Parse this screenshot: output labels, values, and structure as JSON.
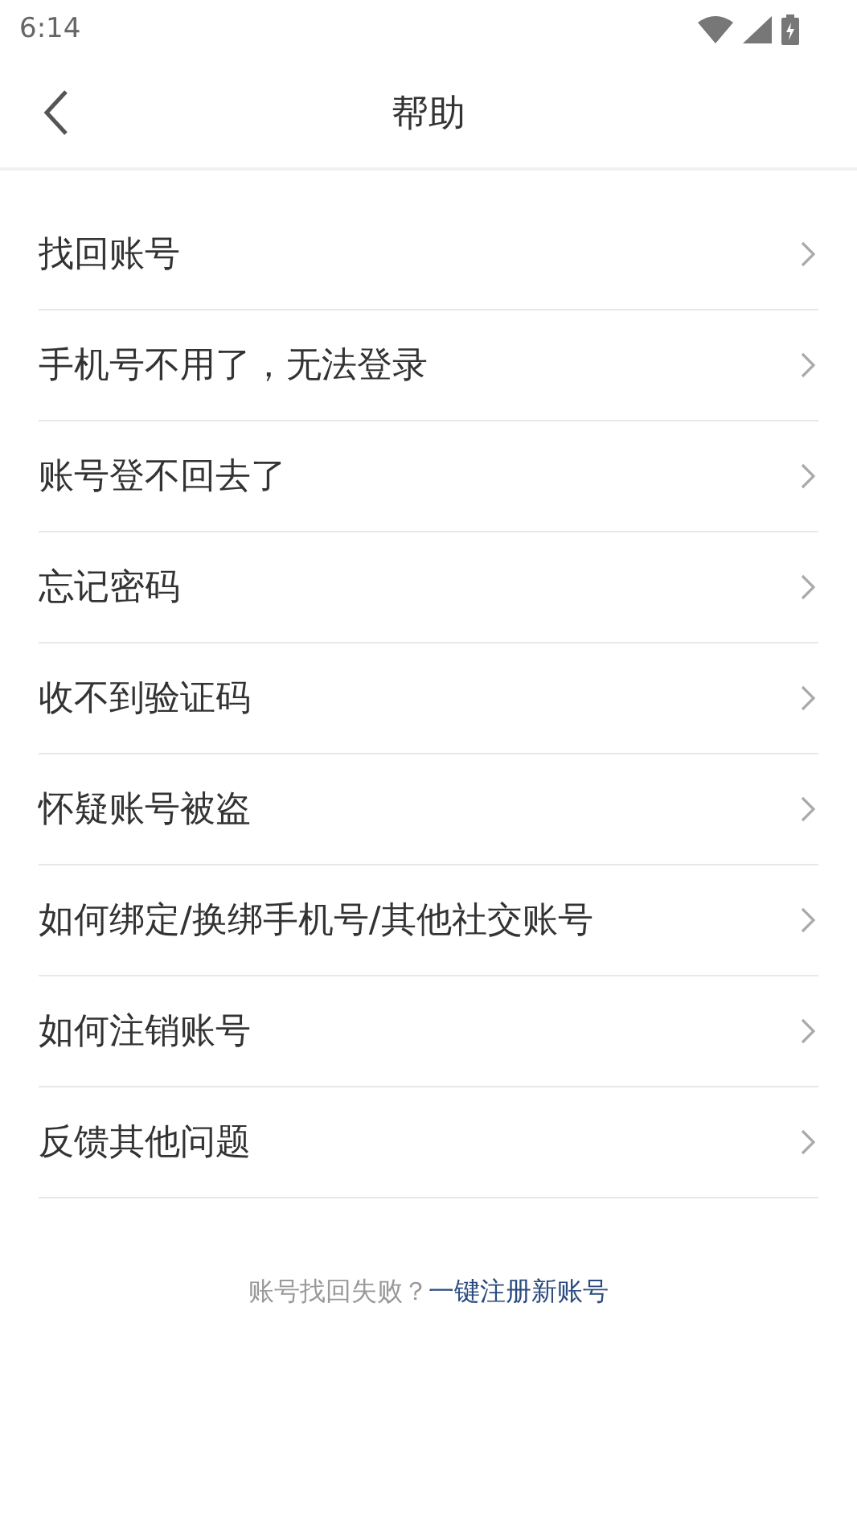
{
  "status_bar": {
    "time": "6:14"
  },
  "header": {
    "title": "帮助"
  },
  "items": [
    {
      "label": "找回账号"
    },
    {
      "label": "手机号不用了，无法登录"
    },
    {
      "label": "账号登不回去了"
    },
    {
      "label": "忘记密码"
    },
    {
      "label": "收不到验证码"
    },
    {
      "label": "怀疑账号被盗"
    },
    {
      "label": "如何绑定/换绑手机号/其他社交账号"
    },
    {
      "label": "如何注销账号"
    },
    {
      "label": "反馈其他问题"
    }
  ],
  "footer": {
    "text": "账号找回失败？",
    "link": "一键注册新账号"
  }
}
